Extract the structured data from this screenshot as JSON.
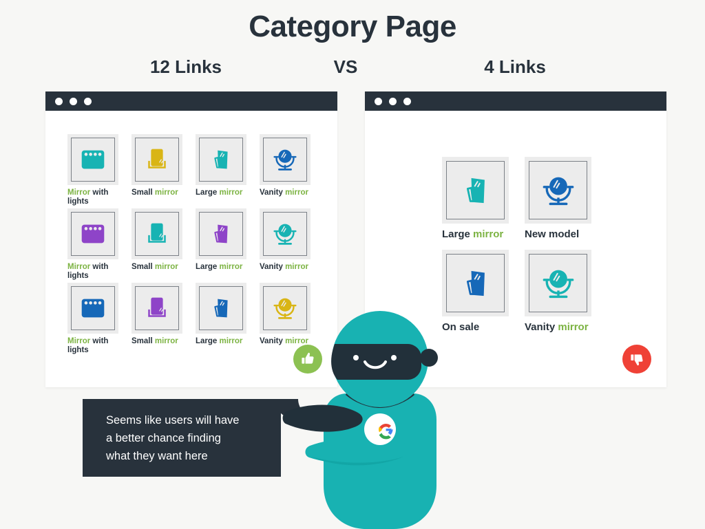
{
  "header": {
    "title": "Category Page",
    "left_subtitle": "12 Links",
    "vs_label": "VS",
    "right_subtitle": "4 Links"
  },
  "colors": {
    "background": "#f7f7f5",
    "ink": "#28323c",
    "highlight_green": "#7cb342",
    "teal": "#17b3b3",
    "purple": "#8e44c8",
    "blue": "#1668b8",
    "yellow": "#d9b515",
    "badge_up": "#8cc152",
    "badge_down": "#ef4136",
    "robot_body": "#18b2b2",
    "robot_dark": "#22303a"
  },
  "left_window": {
    "name": "12-links-category-page",
    "verdict_icon": "thumbs-up-icon",
    "items": [
      {
        "prefix": "Mirror",
        "prefix_highlight": true,
        "suffix": " with lights",
        "suffix_highlight": false,
        "icon": "mirror-with-lights-icon",
        "color": "#17b3b3"
      },
      {
        "prefix": "Small ",
        "prefix_highlight": false,
        "suffix": "mirror",
        "suffix_highlight": true,
        "icon": "small-mirror-icon",
        "color": "#d9b515"
      },
      {
        "prefix": "Large ",
        "prefix_highlight": false,
        "suffix": "mirror",
        "suffix_highlight": true,
        "icon": "large-mirror-icon",
        "color": "#17b3b3"
      },
      {
        "prefix": "Vanity ",
        "prefix_highlight": false,
        "suffix": "mirror",
        "suffix_highlight": true,
        "icon": "vanity-mirror-icon",
        "color": "#1668b8"
      },
      {
        "prefix": "Mirror",
        "prefix_highlight": true,
        "suffix": " with lights",
        "suffix_highlight": false,
        "icon": "mirror-with-lights-icon",
        "color": "#8e44c8"
      },
      {
        "prefix": "Small ",
        "prefix_highlight": false,
        "suffix": "mirror",
        "suffix_highlight": true,
        "icon": "small-mirror-icon",
        "color": "#17b3b3"
      },
      {
        "prefix": "Large ",
        "prefix_highlight": false,
        "suffix": "mirror",
        "suffix_highlight": true,
        "icon": "large-mirror-icon",
        "color": "#8e44c8"
      },
      {
        "prefix": "Vanity ",
        "prefix_highlight": false,
        "suffix": "mirror",
        "suffix_highlight": true,
        "icon": "vanity-mirror-icon",
        "color": "#17b3b3"
      },
      {
        "prefix": "Mirror",
        "prefix_highlight": true,
        "suffix": " with lights",
        "suffix_highlight": false,
        "icon": "mirror-with-lights-icon",
        "color": "#1668b8"
      },
      {
        "prefix": "Small ",
        "prefix_highlight": false,
        "suffix": "mirror",
        "suffix_highlight": true,
        "icon": "small-mirror-icon",
        "color": "#8e44c8"
      },
      {
        "prefix": "Large ",
        "prefix_highlight": false,
        "suffix": "mirror",
        "suffix_highlight": true,
        "icon": "large-mirror-icon",
        "color": "#1668b8"
      },
      {
        "prefix": "Vanity ",
        "prefix_highlight": false,
        "suffix": "mirror",
        "suffix_highlight": true,
        "icon": "vanity-mirror-icon",
        "color": "#d9b515"
      }
    ]
  },
  "right_window": {
    "name": "4-links-category-page",
    "verdict_icon": "thumbs-down-icon",
    "items": [
      {
        "prefix": "Large ",
        "prefix_highlight": false,
        "suffix": "mirror",
        "suffix_highlight": true,
        "icon": "large-mirror-icon",
        "color": "#17b3b3"
      },
      {
        "prefix": "New model",
        "prefix_highlight": false,
        "suffix": "",
        "suffix_highlight": false,
        "icon": "vanity-mirror-icon",
        "color": "#1668b8"
      },
      {
        "prefix": "On sale",
        "prefix_highlight": false,
        "suffix": "",
        "suffix_highlight": false,
        "icon": "large-mirror-icon",
        "color": "#1668b8"
      },
      {
        "prefix": "Vanity ",
        "prefix_highlight": false,
        "suffix": "mirror",
        "suffix_highlight": true,
        "icon": "vanity-mirror-icon",
        "color": "#17b3b3"
      }
    ]
  },
  "speech_bubble": {
    "text": "Seems like users will have\na better chance finding\nwhat they want here"
  },
  "robot": {
    "name": "google-robot-mascot",
    "badge_icon": "google-g-logo"
  }
}
